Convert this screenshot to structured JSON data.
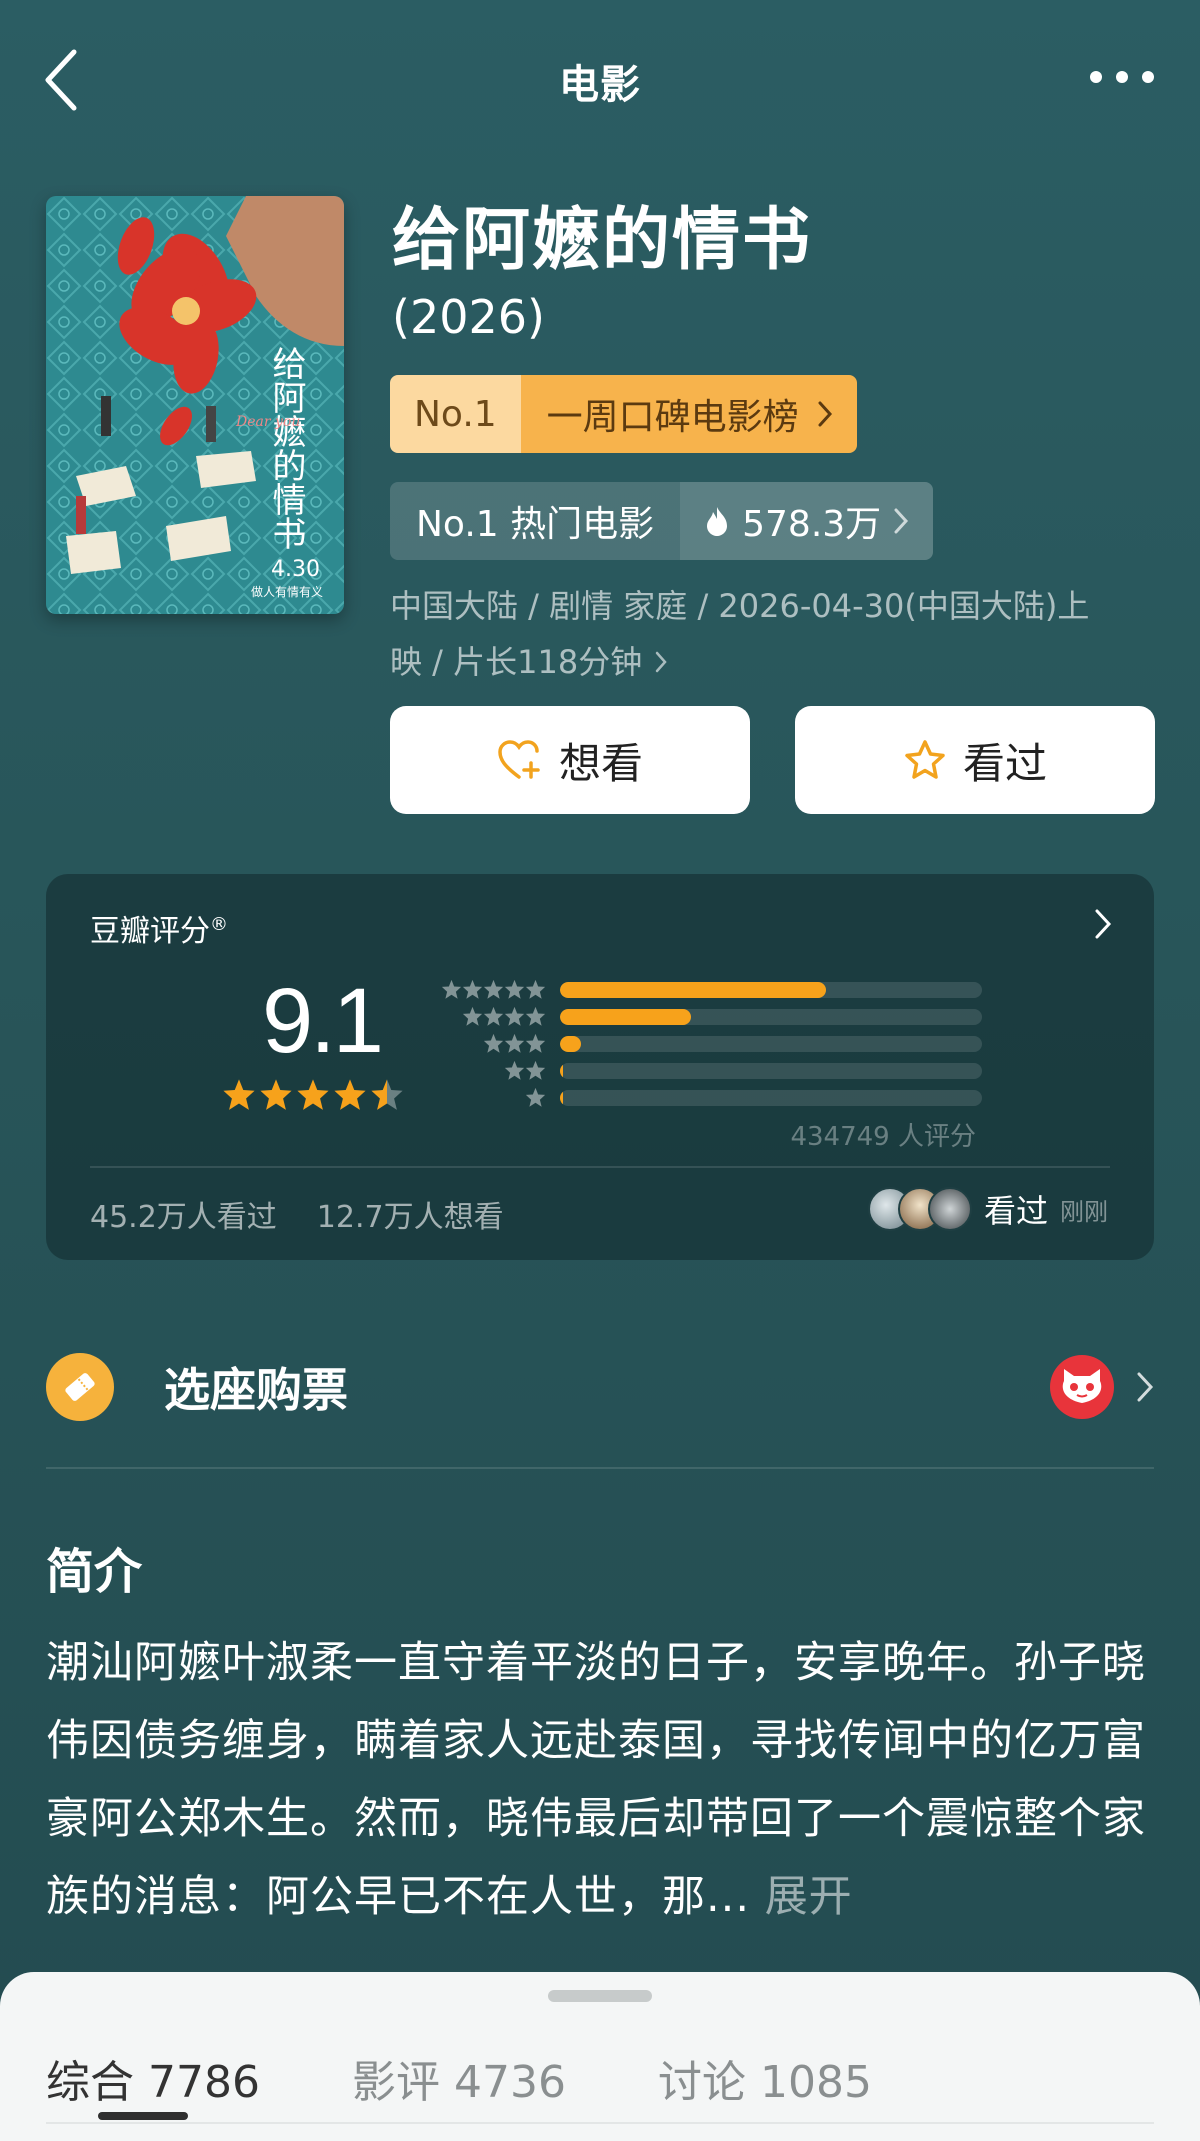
{
  "nav": {
    "title": "电影",
    "back_icon": "chevron-left-icon",
    "more_icon": "more-dots-icon"
  },
  "poster": {
    "title_vertical": "给阿嬷的情书",
    "date": "4.30",
    "tagline": "做人有情有义",
    "overlay": "Dear you"
  },
  "movie": {
    "title": "给阿嬷的情书",
    "year": "(2026)",
    "rank_no": "No.1",
    "rank_label": "一周口碑电影榜",
    "hot_label": "No.1 热门电影",
    "hot_value": "578.3万",
    "meta_line1": "中国大陆 / 剧情 家庭 / 2026-04-30(中国大陆)上",
    "meta_line2": "映 / 片长118分钟"
  },
  "actions": {
    "want": "想看",
    "seen": "看过"
  },
  "rating": {
    "label": "豆瓣评分",
    "reg_mark": "®",
    "score": "9.1",
    "stars": 4.5,
    "distribution": [
      0.63,
      0.31,
      0.05,
      0.007,
      0.004
    ],
    "count": "434749 人评分",
    "seen_count": "45.2万人看过",
    "want_count": "12.7万人想看",
    "friends_seen": "看过",
    "friends_time": "刚刚"
  },
  "ticket": {
    "label": "选座购票",
    "icon": "ticket-icon",
    "partner_icon": "maoyan-cat-icon"
  },
  "intro": {
    "heading": "简介",
    "text": "潮汕阿嬷叶淑柔一直守着平淡的日子，安享晚年。孙子晓伟因债务缠身，瞒着家人远赴泰国，寻找传闻中的亿万富豪阿公郑木生。然而，晓伟最后却带回了一个震惊整个家族的消息：阿公早已不在人世，那...",
    "more": "展开"
  },
  "tabs": [
    {
      "label": "综合",
      "count": "7786"
    },
    {
      "label": "影评",
      "count": "4736"
    },
    {
      "label": "讨论",
      "count": "1085"
    }
  ],
  "colors": {
    "accent": "#f7a21b",
    "bg": "#2b5d63",
    "badge_gold": "#f7b34c"
  }
}
